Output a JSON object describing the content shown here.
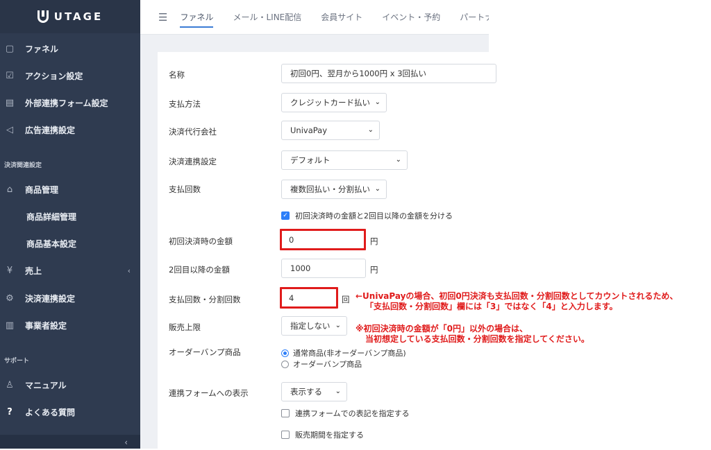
{
  "sidebar": {
    "logo_text": "UTAGE",
    "items": [
      {
        "label": "ファネル",
        "icon": "funnel-icon"
      },
      {
        "label": "アクション設定",
        "icon": "check-square-icon"
      },
      {
        "label": "外部連携フォーム設定",
        "icon": "form-icon"
      },
      {
        "label": "広告連携設定",
        "icon": "megaphone-icon"
      }
    ],
    "payment_heading": "決済関連設定",
    "payment_items": [
      {
        "label": "商品管理",
        "icon": "shop-icon"
      },
      {
        "label": "商品詳細管理"
      },
      {
        "label": "商品基本設定"
      },
      {
        "label": "売上",
        "icon": "yen-icon"
      },
      {
        "label": "決済連携設定",
        "icon": "gear-icon"
      },
      {
        "label": "事業者設定",
        "icon": "building-icon"
      }
    ],
    "support_heading": "サポート",
    "support_items": [
      {
        "label": "マニュアル",
        "icon": "person-icon"
      },
      {
        "label": "よくある質問",
        "icon": "question-icon"
      }
    ]
  },
  "topnav": {
    "tabs": [
      "ファネル",
      "メール・LINE配信",
      "会員サイト",
      "イベント・予約",
      "パートナー"
    ]
  },
  "form": {
    "name": {
      "label": "名称",
      "value": "初回0円、翌月から1000円 x 3回払い"
    },
    "payment_method": {
      "label": "支払方法",
      "value": "クレジットカード払い"
    },
    "agency": {
      "label": "決済代行会社",
      "value": "UnivaPay"
    },
    "integration": {
      "label": "決済連携設定",
      "value": "デフォルト"
    },
    "payment_count": {
      "label": "支払回数",
      "value": "複数回払い・分割払い"
    },
    "split_checkbox": "初回決済時の金額と2回目以降の金額を分ける",
    "first_amount": {
      "label": "初回決済時の金額",
      "value": "0",
      "unit": "円"
    },
    "second_amount": {
      "label": "2回目以降の金額",
      "value": "1000",
      "unit": "円"
    },
    "installments": {
      "label": "支払回数・分割回数",
      "value": "4",
      "unit": "回"
    },
    "sales_limit": {
      "label": "販売上限",
      "value": "指定しない"
    },
    "order_bump": {
      "label": "オーダーバンプ商品",
      "option1": "通常商品(非オーダーバンプ商品)",
      "option2": "オーダーバンプ商品"
    },
    "form_display": {
      "label": "連携フォームへの表示",
      "value": "表示する"
    },
    "form_notation_checkbox": "連携フォームでの表記を指定する",
    "sale_period_checkbox": "販売期間を指定する"
  },
  "annotations": {
    "note1_line1": "←UnivaPayの場合、初回0円決済も支払回数・分割回数としてカウントされるため、",
    "note1_line2": "「支払回数・分割回数」欄には「3」ではなく「4」と入力します。",
    "note2_line1": "※初回決済時の金額が「0円」以外の場合は、",
    "note2_line2": "当初想定している支払回数・分割回数を指定してください。"
  },
  "colors": {
    "sidebar": "#2f3b50",
    "accent": "#3a7bd5",
    "annotation": "#e01b1b"
  }
}
